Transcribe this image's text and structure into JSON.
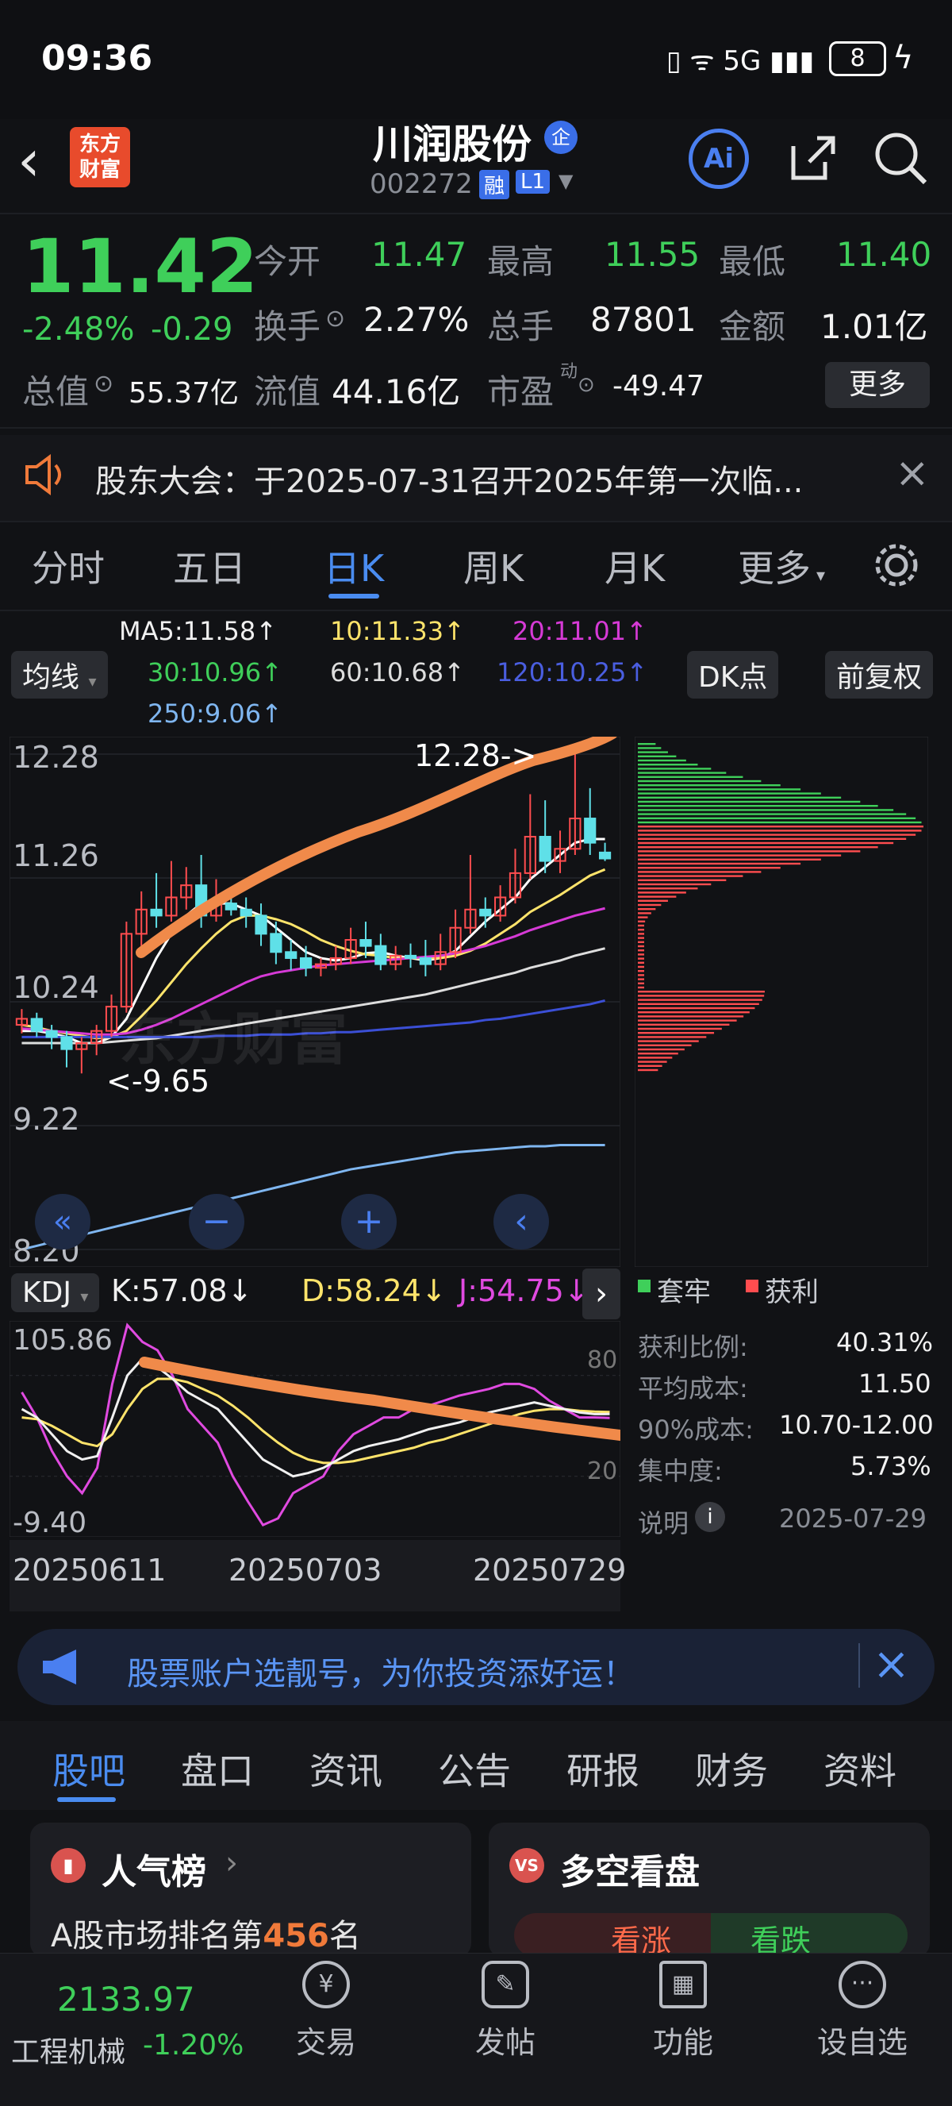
{
  "status_bar": {
    "time": "09:36",
    "battery": "8",
    "net": "5G"
  },
  "header": {
    "logo_line1": "东方",
    "logo_line2": "财富",
    "title": "川润股份",
    "badge": "企",
    "code": "002272",
    "tag1": "融",
    "tag2": "L1"
  },
  "quote": {
    "price": "11.42",
    "change_pct": "-2.48%",
    "change": "-0.29",
    "open_label": "今开",
    "open": "11.47",
    "high_label": "最高",
    "high": "11.55",
    "low_label": "最低",
    "low": "11.40",
    "turnover_label": "换手",
    "turnover": "2.27%",
    "volume_label": "总手",
    "volume": "87801",
    "amount_label": "金额",
    "amount": "1.01亿",
    "mktcap_label": "总值",
    "mktcap": "55.37亿",
    "float_label": "流值",
    "float": "44.16亿",
    "pe_label": "市盈",
    "pe_sup": "动",
    "pe": "-49.47",
    "more": "更多"
  },
  "notice": {
    "text": "股东大会：于2025-07-31召开2025年第一次临...",
    "color": "#f07a3a"
  },
  "chart_tabs": [
    "分时",
    "五日",
    "日K",
    "周K",
    "月K",
    "更多"
  ],
  "chart_controls": {
    "ma_label": "均线",
    "dk": "DK点",
    "adjust": "前复权"
  },
  "ma_legend": {
    "ma5": "MA5:11.58↑",
    "ma10": "10:11.33↑",
    "ma20": "20:11.01↑",
    "ma30": "30:10.96↑",
    "ma60": "60:10.68↑",
    "ma120": "120:10.25↑",
    "ma250": "250:9.06↑"
  },
  "chart_data": {
    "type": "candlestick",
    "y_ticks": [
      "12.28",
      "11.26",
      "10.24",
      "9.22",
      "8.20"
    ],
    "ylim": [
      8.2,
      12.28
    ],
    "annotations": [
      "12.28->",
      "<-9.65"
    ],
    "x_ticks": [
      "20250611",
      "20250703",
      "20250729"
    ],
    "candles": [
      [
        10.05,
        10.1,
        10.18,
        9.98
      ],
      [
        10.1,
        10.0,
        10.15,
        9.95
      ],
      [
        10.0,
        9.95,
        10.05,
        9.85
      ],
      [
        9.95,
        9.85,
        10.0,
        9.7
      ],
      [
        9.85,
        9.9,
        9.95,
        9.65
      ],
      [
        9.9,
        10.0,
        10.05,
        9.8
      ],
      [
        10.0,
        10.2,
        10.3,
        9.95
      ],
      [
        10.2,
        10.8,
        10.9,
        10.15
      ],
      [
        10.8,
        11.0,
        11.15,
        10.7
      ],
      [
        11.0,
        10.95,
        11.3,
        10.85
      ],
      [
        10.95,
        11.1,
        11.4,
        10.9
      ],
      [
        11.1,
        11.2,
        11.35,
        11.0
      ],
      [
        11.2,
        10.95,
        11.45,
        10.85
      ],
      [
        10.95,
        11.05,
        11.25,
        10.9
      ],
      [
        11.05,
        11.0,
        11.15,
        10.95
      ],
      [
        11.0,
        10.95,
        11.1,
        10.85
      ],
      [
        10.95,
        10.8,
        11.05,
        10.7
      ],
      [
        10.8,
        10.65,
        10.9,
        10.55
      ],
      [
        10.65,
        10.6,
        10.75,
        10.5
      ],
      [
        10.6,
        10.52,
        10.7,
        10.45
      ],
      [
        10.52,
        10.55,
        10.6,
        10.45
      ],
      [
        10.55,
        10.6,
        10.7,
        10.5
      ],
      [
        10.6,
        10.75,
        10.85,
        10.55
      ],
      [
        10.75,
        10.7,
        10.9,
        10.6
      ],
      [
        10.7,
        10.55,
        10.8,
        10.5
      ],
      [
        10.55,
        10.62,
        10.7,
        10.5
      ],
      [
        10.62,
        10.6,
        10.72,
        10.52
      ],
      [
        10.6,
        10.55,
        10.75,
        10.45
      ],
      [
        10.55,
        10.65,
        10.8,
        10.5
      ],
      [
        10.65,
        10.85,
        11.0,
        10.6
      ],
      [
        10.85,
        11.0,
        11.45,
        10.8
      ],
      [
        11.0,
        10.95,
        11.1,
        10.85
      ],
      [
        10.95,
        11.1,
        11.2,
        10.9
      ],
      [
        11.1,
        11.3,
        11.5,
        11.05
      ],
      [
        11.3,
        11.6,
        11.95,
        11.25
      ],
      [
        11.6,
        11.4,
        11.9,
        11.3
      ],
      [
        11.4,
        11.5,
        11.65,
        11.3
      ],
      [
        11.5,
        11.75,
        12.28,
        11.45
      ],
      [
        11.75,
        11.55,
        12.0,
        11.45
      ],
      [
        11.47,
        11.42,
        11.55,
        11.4
      ]
    ],
    "ma_series": [
      {
        "name": "MA5",
        "color": "#ffffff",
        "values": [
          10.0,
          10.0,
          9.98,
          9.95,
          9.9,
          9.9,
          9.95,
          10.1,
          10.35,
          10.6,
          10.8,
          10.95,
          11.05,
          11.05,
          11.05,
          11.0,
          10.95,
          10.85,
          10.75,
          10.65,
          10.6,
          10.58,
          10.6,
          10.64,
          10.65,
          10.62,
          10.6,
          10.58,
          10.6,
          10.66,
          10.78,
          10.9,
          11.0,
          11.1,
          11.25,
          11.35,
          11.45,
          11.55,
          11.58,
          11.58
        ]
      },
      {
        "name": "MA10",
        "color": "#ffe46b",
        "values": [
          10.05,
          10.03,
          10.0,
          9.98,
          9.96,
          9.94,
          9.95,
          10.0,
          10.12,
          10.25,
          10.4,
          10.55,
          10.68,
          10.8,
          10.9,
          10.95,
          10.95,
          10.92,
          10.88,
          10.82,
          10.75,
          10.7,
          10.66,
          10.63,
          10.62,
          10.6,
          10.6,
          10.6,
          10.6,
          10.62,
          10.66,
          10.72,
          10.8,
          10.88,
          10.98,
          11.05,
          11.12,
          11.2,
          11.28,
          11.33
        ]
      },
      {
        "name": "MA20",
        "color": "#d63ad6",
        "values": [
          10.02,
          10.01,
          10.0,
          9.99,
          9.98,
          9.97,
          9.97,
          9.98,
          10.01,
          10.05,
          10.1,
          10.16,
          10.22,
          10.28,
          10.34,
          10.4,
          10.45,
          10.48,
          10.5,
          10.52,
          10.54,
          10.55,
          10.56,
          10.57,
          10.58,
          10.59,
          10.6,
          10.61,
          10.62,
          10.64,
          10.67,
          10.7,
          10.74,
          10.78,
          10.83,
          10.87,
          10.91,
          10.95,
          10.98,
          11.01
        ]
      },
      {
        "name": "MA60",
        "color": "#dddddd",
        "values": [
          9.9,
          9.9,
          9.9,
          9.9,
          9.9,
          9.9,
          9.91,
          9.92,
          9.93,
          9.94,
          9.96,
          9.98,
          10.0,
          10.02,
          10.04,
          10.06,
          10.08,
          10.1,
          10.12,
          10.14,
          10.16,
          10.18,
          10.2,
          10.22,
          10.24,
          10.26,
          10.28,
          10.3,
          10.33,
          10.36,
          10.39,
          10.42,
          10.45,
          10.48,
          10.52,
          10.55,
          10.58,
          10.62,
          10.65,
          10.68
        ]
      },
      {
        "name": "MA120",
        "color": "#3b4fd6",
        "values": [
          9.95,
          9.95,
          9.95,
          9.95,
          9.95,
          9.95,
          9.95,
          9.95,
          9.95,
          9.95,
          9.95,
          9.95,
          9.95,
          9.96,
          9.96,
          9.96,
          9.97,
          9.97,
          9.97,
          9.98,
          9.98,
          9.99,
          9.99,
          10.0,
          10.01,
          10.02,
          10.03,
          10.04,
          10.05,
          10.06,
          10.07,
          10.09,
          10.1,
          10.12,
          10.14,
          10.16,
          10.18,
          10.2,
          10.22,
          10.25
        ]
      },
      {
        "name": "MA250",
        "color": "#7fb6f0",
        "values": [
          8.2,
          8.23,
          8.26,
          8.29,
          8.32,
          8.35,
          8.38,
          8.41,
          8.44,
          8.47,
          8.5,
          8.53,
          8.56,
          8.59,
          8.62,
          8.65,
          8.68,
          8.71,
          8.74,
          8.77,
          8.8,
          8.83,
          8.86,
          8.88,
          8.9,
          8.92,
          8.94,
          8.96,
          8.98,
          9.0,
          9.01,
          9.02,
          9.03,
          9.04,
          9.05,
          9.05,
          9.06,
          9.06,
          9.06,
          9.06
        ]
      }
    ],
    "kdj": {
      "y_ticks": [
        "105.86",
        "-9.40"
      ],
      "right_ticks": [
        "80",
        "20"
      ],
      "K": [
        60,
        55,
        45,
        35,
        30,
        32,
        55,
        80,
        90,
        85,
        78,
        70,
        65,
        60,
        50,
        40,
        30,
        25,
        20,
        22,
        25,
        30,
        35,
        38,
        40,
        42,
        45,
        48,
        50,
        52,
        55,
        58,
        60,
        62,
        64,
        62,
        60,
        58,
        57,
        57.08
      ],
      "D": [
        55,
        54,
        50,
        45,
        40,
        38,
        45,
        60,
        72,
        78,
        78,
        76,
        72,
        68,
        62,
        55,
        47,
        40,
        34,
        30,
        28,
        28,
        29,
        31,
        33,
        35,
        37,
        40,
        42,
        45,
        48,
        51,
        54,
        57,
        59,
        60,
        60,
        59,
        58.5,
        58.24
      ],
      "J": [
        70,
        55,
        35,
        20,
        10,
        25,
        75,
        110,
        100,
        95,
        80,
        60,
        50,
        40,
        20,
        5,
        -9,
        -5,
        10,
        15,
        20,
        35,
        45,
        50,
        55,
        55,
        60,
        62,
        65,
        68,
        70,
        72,
        75,
        75,
        72,
        65,
        60,
        55,
        55,
        54.75
      ]
    }
  },
  "kdj_header": {
    "label": "KDJ",
    "k": "K:57.08↓",
    "d": "D:58.24↓",
    "j": "J:54.75↓"
  },
  "chips": {
    "legend_trapped": "套牢",
    "legend_profit": "获利",
    "profit_ratio_label": "获利比例:",
    "profit_ratio": "40.31%",
    "avg_cost_label": "平均成本:",
    "avg_cost": "11.50",
    "cost90_label": "90%成本:",
    "cost90": "10.70-12.00",
    "concentration_label": "集中度:",
    "concentration": "5.73%",
    "note_label": "说明",
    "date": "2025-07-29"
  },
  "ad": {
    "text": "股票账户选靓号，为你投资添好运！"
  },
  "bottom_tabs": [
    "股吧",
    "盘口",
    "资讯",
    "公告",
    "研报",
    "财务",
    "资料"
  ],
  "cards": {
    "popularity_title": "人气榜",
    "rank_prefix": "A股市场排名第",
    "rank": "456",
    "rank_suffix": "名",
    "duokong_title": "多空看盘",
    "bull": "看涨",
    "bear": "看跌"
  },
  "footer": {
    "index_value": "2133.97",
    "index_name": "工程机械",
    "index_change": "-1.20%",
    "trade": "交易",
    "post": "发帖",
    "func": "功能",
    "watch": "设自选"
  }
}
